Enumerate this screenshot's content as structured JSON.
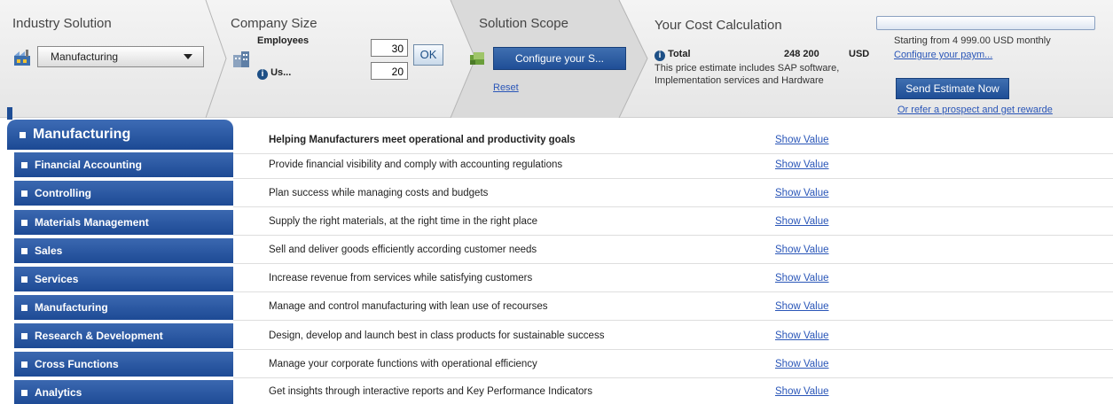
{
  "header": {
    "industry": {
      "title": "Industry Solution",
      "selected": "Manufacturing"
    },
    "company": {
      "title": "Company Size",
      "employees_label": "Employees",
      "employees_value": "30",
      "users_label": "Us...",
      "users_value": "20",
      "ok_label": "OK"
    },
    "scope": {
      "title": "Solution Scope",
      "configure_label": "Configure your S...",
      "reset_label": "Reset"
    },
    "cost": {
      "title": "Your Cost Calculation",
      "total_label": "Total",
      "total_value": "248 200",
      "currency": "USD",
      "note": "This price estimate includes SAP software, Implementation services and Hardware"
    },
    "right": {
      "monthly_text": "Starting from 4 999.00 USD monthly",
      "configure_payment": "Configure your paym...",
      "send_estimate": "Send Estimate Now",
      "refer": "Or refer a prospect and get rewarde"
    }
  },
  "sidebar": {
    "header": "Manufacturing",
    "items": [
      {
        "label": "Financial Accounting"
      },
      {
        "label": "Controlling"
      },
      {
        "label": "Materials Management"
      },
      {
        "label": "Sales"
      },
      {
        "label": "Services"
      },
      {
        "label": "Manufacturing"
      },
      {
        "label": "Research & Development"
      },
      {
        "label": "Cross Functions"
      },
      {
        "label": "Analytics"
      }
    ]
  },
  "rows": [
    {
      "description": "Helping Manufacturers meet operational and productivity goals",
      "link": "Show Value"
    },
    {
      "description": "Provide financial visibility and comply with accounting regulations",
      "link": "Show Value"
    },
    {
      "description": "Plan success while managing costs and budgets",
      "link": "Show Value"
    },
    {
      "description": "Supply the right materials, at the right time in the right place",
      "link": "Show Value"
    },
    {
      "description": "Sell and deliver goods efficiently according customer needs",
      "link": "Show Value"
    },
    {
      "description": "Increase revenue from services while satisfying customers",
      "link": "Show Value"
    },
    {
      "description": "Manage and control manufacturing with lean use of recourses",
      "link": "Show Value"
    },
    {
      "description": "Design, develop and launch best in class products for sustainable success",
      "link": "Show Value"
    },
    {
      "description": "Manage your corporate functions with operational efficiency",
      "link": "Show Value"
    },
    {
      "description": "Get insights through interactive reports and Key Performance Indicators",
      "link": "Show Value"
    }
  ],
  "colors": {
    "brand_blue": "#1f4e96",
    "link_blue": "#2a56b8"
  }
}
